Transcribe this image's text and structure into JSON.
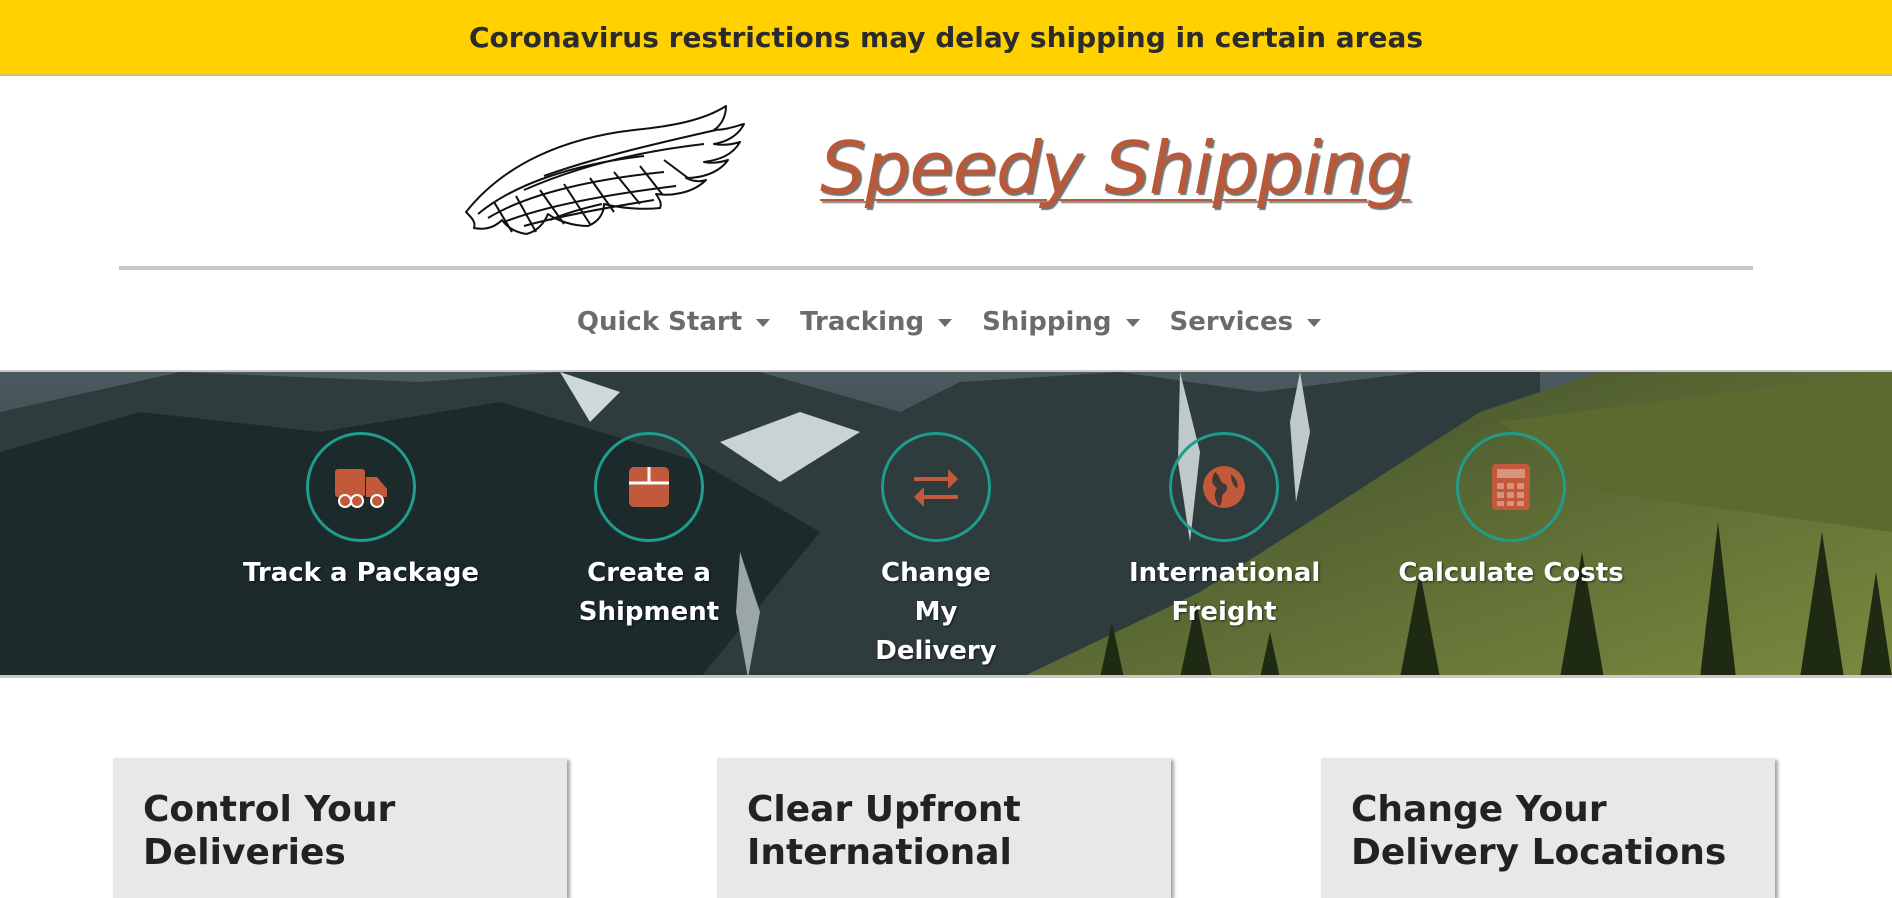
{
  "banner": {
    "text": "Coronavirus restrictions may delay shipping in certain areas"
  },
  "brand": {
    "name": "Speedy Shipping",
    "logo_icon": "wing-icon"
  },
  "nav": {
    "items": [
      {
        "label": "Quick Start"
      },
      {
        "label": "Tracking"
      },
      {
        "label": "Shipping"
      },
      {
        "label": "Services"
      }
    ]
  },
  "quick_links": [
    {
      "label": "Track a Package",
      "icon": "truck-icon"
    },
    {
      "label": "Create a Shipment",
      "icon": "box-icon"
    },
    {
      "label": "Change My Delivery",
      "icon": "exchange-arrows-icon"
    },
    {
      "label": "International Freight",
      "icon": "globe-icon"
    },
    {
      "label": "Calculate Costs",
      "icon": "calculator-icon"
    }
  ],
  "cards": [
    {
      "title": "Control Your Deliveries"
    },
    {
      "title": "Clear Upfront International"
    },
    {
      "title": "Change Your Delivery Locations"
    }
  ],
  "colors": {
    "banner": "#ffd100",
    "brand": "#b85a3a",
    "icon_accent": "#c2593a",
    "circle_border": "#1f9c8e",
    "nav_text": "#6b6b6b",
    "card_bg": "#e8e8e6"
  }
}
